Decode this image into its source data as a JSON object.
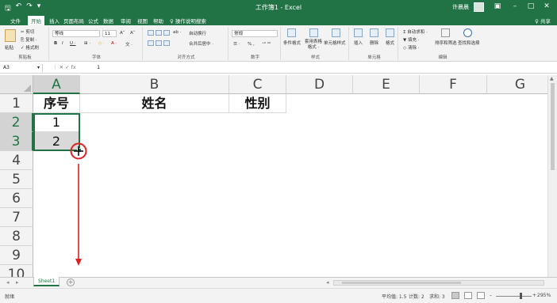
{
  "titlebar": {
    "title": "工作簿1 - Excel",
    "user": "许晨晨",
    "qa_save": "🖫",
    "qa_undo": "↶",
    "qa_redo": "↷",
    "qa_custom": "▾",
    "ctrl_min": "–",
    "ctrl_max": "□",
    "ctrl_close": "✕",
    "ctrl_ribbon": "▣"
  },
  "menu": {
    "tabs": [
      "文件",
      "开始",
      "插入",
      "页面布局",
      "公式",
      "数据",
      "审阅",
      "视图",
      "帮助",
      "♀ 操作说明搜索"
    ],
    "active_index": 1,
    "share": "♀ 共享"
  },
  "ribbon": {
    "clipboard": {
      "paste": "粘贴",
      "cut": "✂ 剪切",
      "copy": "⎘ 复制 ·",
      "format_painter": "✓ 格式刷",
      "label": "剪贴板"
    },
    "font": {
      "name": "等线",
      "size": "11",
      "grow": "A˄",
      "shrink": "A˅",
      "bold": "B",
      "italic": "I",
      "underline": "U ·",
      "border": "⊞ ·",
      "fill": "◇ ·",
      "color": "A ·",
      "phonetic": "文 ·",
      "label": "字体"
    },
    "alignment": {
      "wrap": "自动换行",
      "merge": "合并后居中 ·",
      "orient": "ab ·",
      "label": "对齐方式"
    },
    "number": {
      "format": "常规",
      "percent": "% ,",
      "decimals": "⁺⁰ ⁰⁰",
      "currency": "☰ ·",
      "label": "数字"
    },
    "styles": {
      "conditional": "条件格式",
      "table": "套用表格格式 ·",
      "cell": "单元格样式",
      "label": "样式"
    },
    "cells": {
      "insert": "插入",
      "delete": "删除",
      "format": "格式",
      "label": "单元格"
    },
    "editing": {
      "autosum": "Σ 自动求和 ·",
      "fill": "▼ 填充 ·",
      "clear": "◇ 清除 ·",
      "sort": "排序和筛选",
      "find": "查找和选择",
      "label": "编辑"
    }
  },
  "formula_bar": {
    "name_box": "A3",
    "name_dd": "▾",
    "icons": "⋮  ✕  ✓  fx",
    "value": "1"
  },
  "grid": {
    "columns": [
      "A",
      "B",
      "C",
      "D",
      "E",
      "F",
      "G"
    ],
    "rows": [
      "1",
      "2",
      "3",
      "4",
      "5",
      "6",
      "7",
      "8",
      "9",
      "10"
    ],
    "cells": {
      "A1": "序号",
      "B1": "姓名",
      "C1": "性别",
      "A2": "1",
      "A3": "2"
    }
  },
  "sheet_tabs": {
    "tabs": [
      "Sheet1"
    ],
    "add": "+",
    "nav_left": "◂",
    "nav_right": "▸",
    "hleft": "◂"
  },
  "status_bar": {
    "ready": "就绪",
    "average": "平均值: 1.5",
    "count": "计数: 2",
    "sum": "求和: 3",
    "zoom": "295%",
    "zoom_minus": "–",
    "zoom_plus": "+"
  },
  "colors": {
    "accent": "#217346",
    "marker": "#e02020"
  }
}
